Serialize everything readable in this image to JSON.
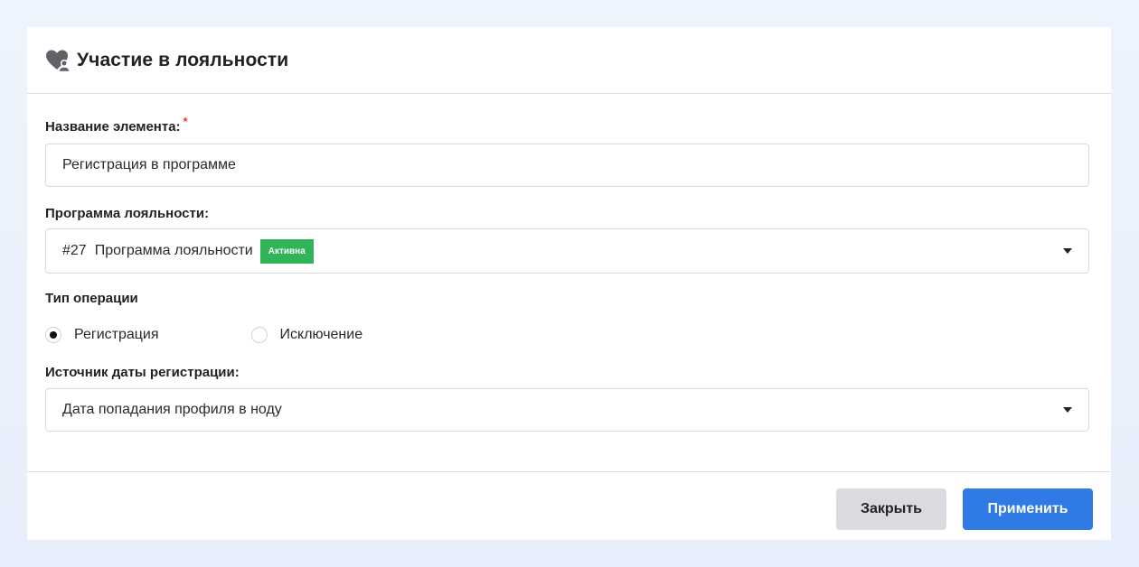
{
  "dialog": {
    "title": "Участие в лояльности",
    "icon": "heart-user-icon"
  },
  "form": {
    "name_label": "Название элемента:",
    "name_required_mark": "*",
    "name_value": "Регистрация в программе",
    "program_label": "Программа лояльности:",
    "program_id": "#27",
    "program_name": "Программа лояльности",
    "program_status": "Активна",
    "operation_label": "Тип операции",
    "operation_options": [
      {
        "label": "Регистрация",
        "selected": true
      },
      {
        "label": "Исключение",
        "selected": false
      }
    ],
    "date_source_label": "Источник даты регистрации:",
    "date_source_value": "Дата попадания профиля в ноду"
  },
  "footer": {
    "close_label": "Закрыть",
    "apply_label": "Применить"
  },
  "colors": {
    "accent": "#2f7ae5",
    "status_active": "#2fb457",
    "required": "#e53935"
  }
}
